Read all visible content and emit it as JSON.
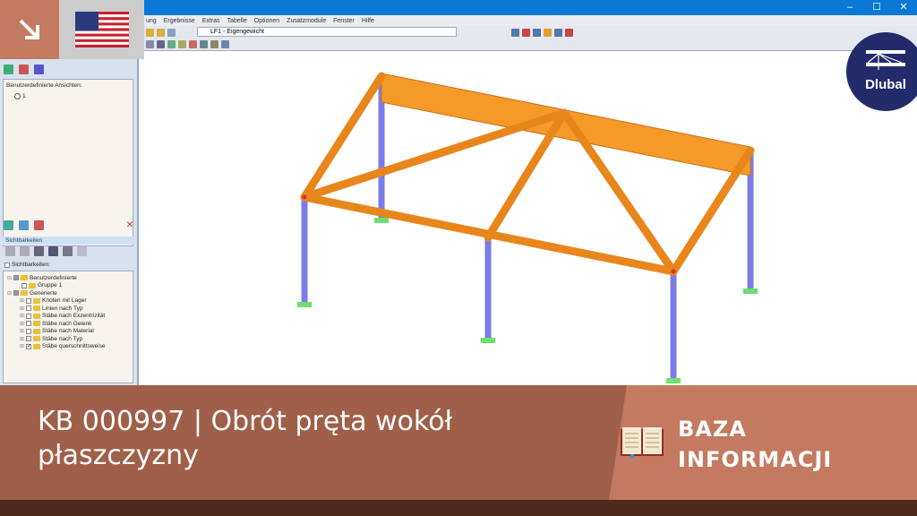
{
  "window": {
    "controls": [
      "–",
      "☐",
      "✕"
    ]
  },
  "menu": [
    "ung",
    "Ergebnisse",
    "Extras",
    "Tabelle",
    "Optionen",
    "Zusatzmodule",
    "Fenster",
    "Hilfe"
  ],
  "toolbar": {
    "load_case": "LF1 - Eigengewicht"
  },
  "navigator": {
    "views_label": "Benutzerdefinierte Ansichten:",
    "view_item": "1",
    "visibility_header": "Sichtbarkeiten",
    "visibility_checkbox": "Sichtbarkeiten:",
    "tree": [
      {
        "label": "Benutzerdefinierte",
        "level": 0,
        "checked": "partial"
      },
      {
        "label": "Gruppe 1",
        "level": 1,
        "checked": false
      },
      {
        "label": "Generierte",
        "level": 0,
        "checked": "partial"
      },
      {
        "label": "Knoten mit Lager",
        "level": 1,
        "checked": false
      },
      {
        "label": "Linien nach Typ",
        "level": 1,
        "checked": false
      },
      {
        "label": "Stäbe nach Exzentrizität",
        "level": 1,
        "checked": false
      },
      {
        "label": "Stäbe nach Gelenk",
        "level": 1,
        "checked": false
      },
      {
        "label": "Stäbe nach Material",
        "level": 1,
        "checked": false
      },
      {
        "label": "Stäbe nach Typ",
        "level": 1,
        "checked": false
      },
      {
        "label": "Stäbe querschnittsweise",
        "level": 1,
        "checked": true
      }
    ]
  },
  "logo": {
    "text": "Dlubal"
  },
  "banner": {
    "title": "KB 000997 | Obrót pręta wokół płaszczyzny",
    "category_line1": "BAZA",
    "category_line2": "INFORMACJI"
  },
  "colors": {
    "accent": "#c47a60",
    "banner_dark": "#a05f48",
    "member": "#f08c1e",
    "column": "#7a7ae6",
    "logo": "#232b6b"
  }
}
